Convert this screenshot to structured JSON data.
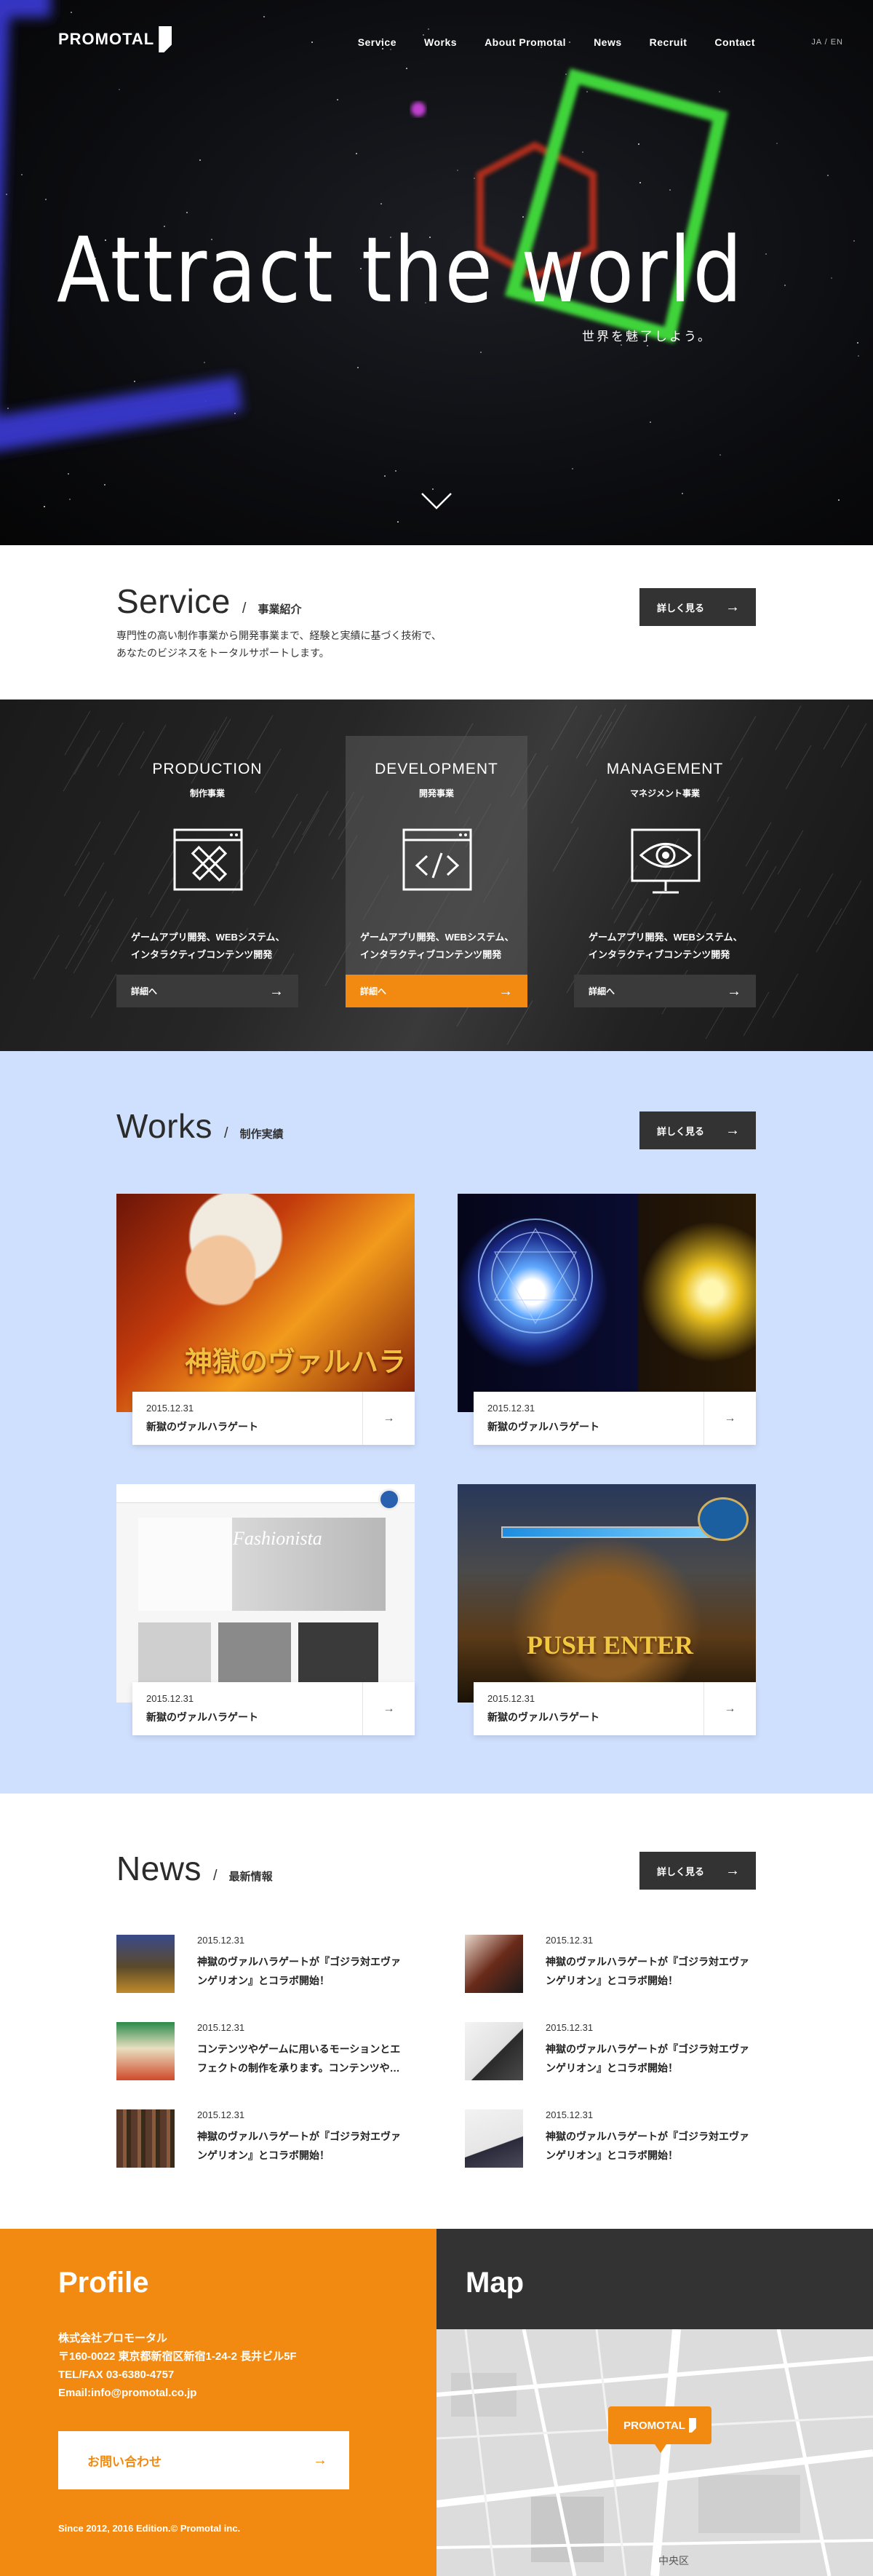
{
  "brand": {
    "logo_text": "PROMOTAL",
    "accent": "#f28a12",
    "dark": "#333333",
    "works_bg": "#cfe0fe"
  },
  "nav": {
    "items": [
      "Service",
      "Works",
      "About Promotal",
      "News",
      "Recruit",
      "Contact"
    ],
    "lang": "JA / EN"
  },
  "hero": {
    "title": "Attract the world",
    "subtitle": "世界を魅了しよう。",
    "scroll_icon": "chevron-down-icon"
  },
  "service": {
    "title": "Service",
    "subtitle": "事業紹介",
    "more": "詳しく見る",
    "intro": [
      "専門性の高い制作事業から開発事業まで、経験と実績に基づく技術で、",
      "あなたのビジネスをトータルサポートします。"
    ],
    "columns": [
      {
        "name": "PRODUCTION",
        "jp": "制作事業",
        "icon": "pencil-ruler-icon",
        "desc": [
          "ゲームアプリ開発、WEBシステム、",
          "インタラクティブコンテンツ開発"
        ],
        "btn": "詳細へ",
        "active": false
      },
      {
        "name": "DEVELOPMENT",
        "jp": "開発事業",
        "icon": "code-window-icon",
        "desc": [
          "ゲームアプリ開発、WEBシステム、",
          "インタラクティブコンテンツ開発"
        ],
        "btn": "詳細へ",
        "active": true
      },
      {
        "name": "MANAGEMENT",
        "jp": "マネジメント事業",
        "icon": "eye-monitor-icon",
        "desc": [
          "ゲームアプリ開発、WEBシステム、",
          "インタラクティブコンテンツ開発"
        ],
        "btn": "詳細へ",
        "active": false
      }
    ]
  },
  "works": {
    "title": "Works",
    "subtitle": "制作実績",
    "more": "詳しく見る",
    "items": [
      {
        "date": "2015.12.31",
        "name": "新獄のヴァルハラゲート",
        "image_text": "神獄のヴァルハラ"
      },
      {
        "date": "2015.12.31",
        "name": "新獄のヴァルハラゲート",
        "image_text": ""
      },
      {
        "date": "2015.12.31",
        "name": "新獄のヴァルハラゲート",
        "image_text": "Fashionista"
      },
      {
        "date": "2015.12.31",
        "name": "新獄のヴァルハラゲート",
        "image_text": "PUSH ENTER"
      }
    ]
  },
  "news": {
    "title": "News",
    "subtitle": "最新情報",
    "more": "詳しく見る",
    "items": [
      {
        "date": "2015.12.31",
        "text": [
          "神獄のヴァルハラゲートが『ゴジラ対エヴァ",
          "ンゲリオン』とコラボ開始！"
        ]
      },
      {
        "date": "2015.12.31",
        "text": [
          "神獄のヴァルハラゲートが『ゴジラ対エヴァ",
          "ンゲリオン』とコラボ開始！"
        ]
      },
      {
        "date": "2015.12.31",
        "text": [
          "コンテンツやゲームに用いるモーションとエ",
          "フェクトの制作を承ります。コンテンツや…"
        ]
      },
      {
        "date": "2015.12.31",
        "text": [
          "神獄のヴァルハラゲートが『ゴジラ対エヴァ",
          "ンゲリオン』とコラボ開始！"
        ]
      },
      {
        "date": "2015.12.31",
        "text": [
          "神獄のヴァルハラゲートが『ゴジラ対エヴァ",
          "ンゲリオン』とコラボ開始！"
        ]
      },
      {
        "date": "2015.12.31",
        "text": [
          "神獄のヴァルハラゲートが『ゴジラ対エヴァ",
          "ンゲリオン』とコラボ開始！"
        ]
      }
    ]
  },
  "profile": {
    "title": "Profile",
    "company": "株式会社プロモータル",
    "address": "〒160-0022 東京都新宿区新宿1-24-2 長井ビル5F",
    "tel": "TEL/FAX 03-6380-4757",
    "email": "Email:info@promotal.co.jp",
    "contact": "お問い合わせ",
    "copyright": "Since 2012, 2016 Edition.© Promotal inc."
  },
  "map": {
    "title": "Map",
    "pin_label": "PROMOTAL",
    "area_label": "中央区"
  }
}
